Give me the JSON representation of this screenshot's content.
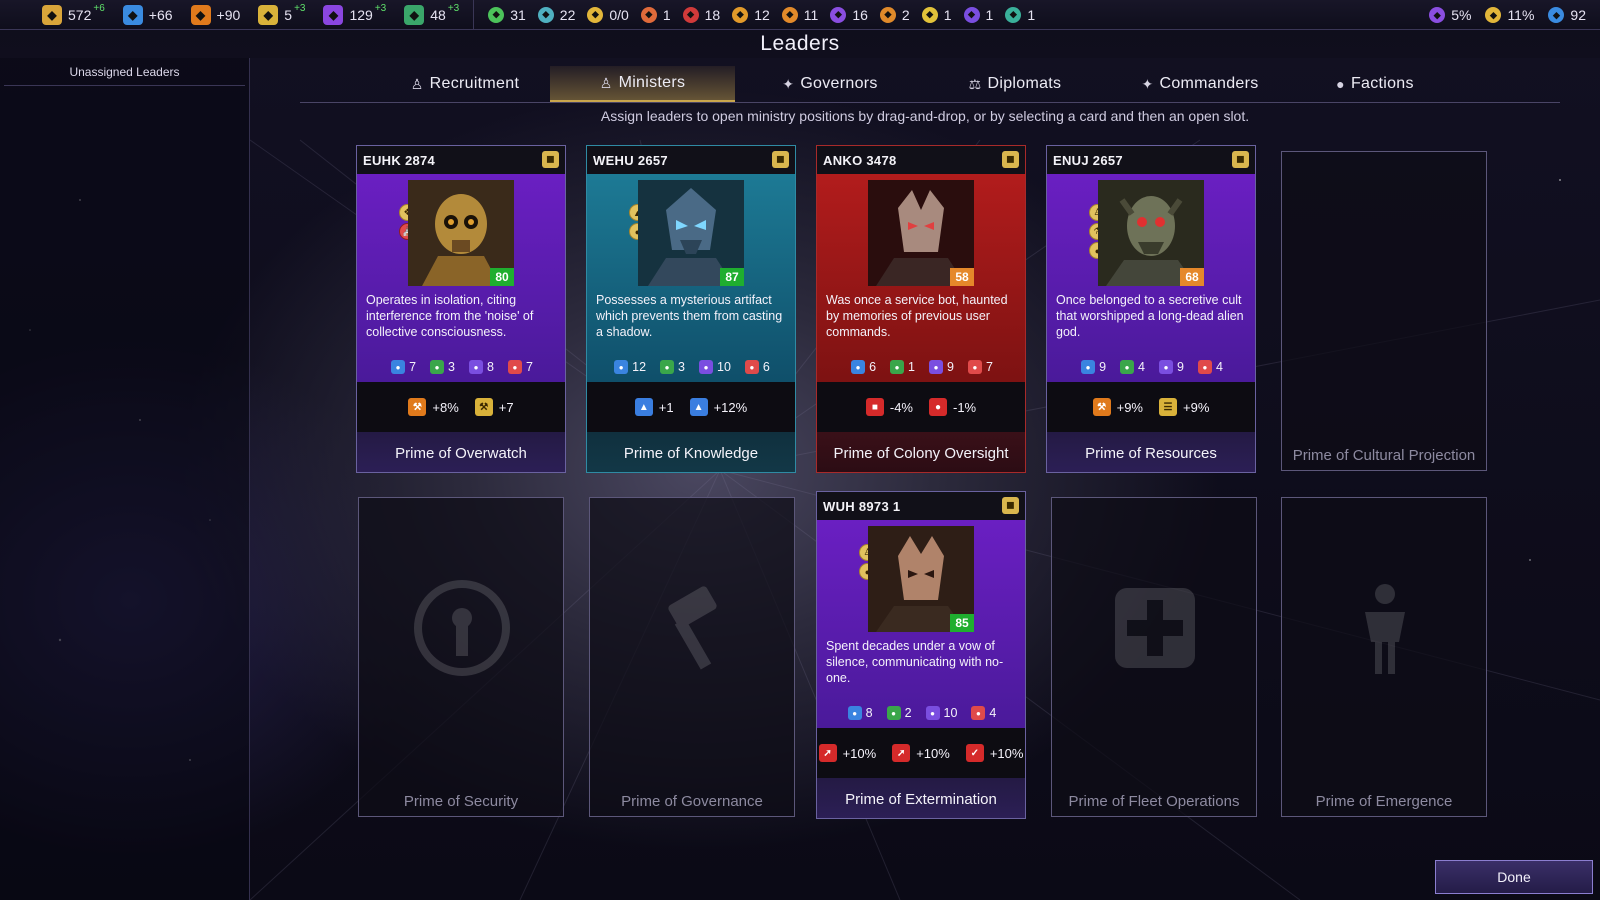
{
  "window": {
    "title": "Leaders"
  },
  "topbar": {
    "resources": [
      {
        "icon": "influence-icon",
        "value": "572",
        "delta": "+6",
        "color": "#d9a53a"
      },
      {
        "icon": "science-icon",
        "value": "+66",
        "delta": "",
        "color": "#3a8be0"
      },
      {
        "icon": "industry-icon",
        "value": "+90",
        "delta": "",
        "color": "#e07a1c"
      },
      {
        "icon": "approval-icon",
        "value": "5",
        "delta": "+3",
        "color": "#d9b23a"
      },
      {
        "icon": "manpower-icon",
        "value": "129",
        "delta": "+3",
        "color": "#8a46e0"
      },
      {
        "icon": "food-icon",
        "value": "48",
        "delta": "+3",
        "color": "#3aa66a"
      }
    ],
    "strategic": [
      {
        "icon": "titanium-icon",
        "value": "31",
        "color": "#4cc25a"
      },
      {
        "icon": "hyperium-icon",
        "value": "22",
        "color": "#4fb0c0"
      },
      {
        "icon": "energy-icon",
        "value": "0/0",
        "color": "#e2b63a"
      },
      {
        "icon": "weapons-icon",
        "value": "1",
        "color": "#e06a3a"
      },
      {
        "icon": "antimatter-icon",
        "value": "18",
        "color": "#d03a3a"
      },
      {
        "icon": "ore-icon",
        "value": "12",
        "color": "#e29a2a"
      },
      {
        "icon": "luxury-icon",
        "value": "11",
        "color": "#e28a2a"
      },
      {
        "icon": "dust-icon",
        "value": "16",
        "color": "#8a4ee0"
      },
      {
        "icon": "crystal-icon",
        "value": "2",
        "color": "#e08a2a"
      },
      {
        "icon": "spice-icon",
        "value": "1",
        "color": "#e2c23a"
      },
      {
        "icon": "void-icon",
        "value": "1",
        "color": "#7a4ee0"
      },
      {
        "icon": "gem-icon",
        "value": "1",
        "color": "#3ab09a"
      }
    ],
    "right": [
      {
        "icon": "victory-icon",
        "value": "5%",
        "color": "#8a4ee0"
      },
      {
        "icon": "trophy-icon",
        "value": "11%",
        "color": "#e2b63a"
      },
      {
        "icon": "turn-icon",
        "value": "92",
        "color": "#3a8be0"
      }
    ]
  },
  "left_panel": {
    "header": "Unassigned Leaders"
  },
  "tabs": [
    {
      "label": "Recruitment",
      "icon": "recruitment-icon",
      "active": false
    },
    {
      "label": "Ministers",
      "icon": "ministers-icon",
      "active": true
    },
    {
      "label": "Governors",
      "icon": "governors-icon",
      "active": false
    },
    {
      "label": "Diplomats",
      "icon": "diplomats-icon",
      "active": false
    },
    {
      "label": "Commanders",
      "icon": "commanders-icon",
      "active": false
    },
    {
      "label": "Factions",
      "icon": "factions-icon",
      "active": false
    }
  ],
  "instruction": "Assign leaders to open ministry positions by drag-and-drop, or by selecting a card and then an open slot.",
  "cards": [
    {
      "name": "EUHK 2874",
      "level": "80",
      "color": "purple",
      "desc": "Operates in isolation, citing interference from the 'noise' of collective consciousness.",
      "stats": [
        "7",
        "3",
        "8",
        "7"
      ],
      "bonuses": [
        {
          "icon": "industry-icon",
          "value": "+8%"
        },
        {
          "icon": "ore-icon",
          "value": "+7"
        }
      ],
      "position": "Prime of Overwatch"
    },
    {
      "name": "WEHU 2657",
      "level": "87",
      "color": "teal",
      "desc": "Possesses a mysterious artifact which prevents them from casting a shadow.",
      "stats": [
        "12",
        "3",
        "10",
        "6"
      ],
      "bonuses": [
        {
          "icon": "science-icon",
          "value": "+1"
        },
        {
          "icon": "science-icon",
          "value": "+12%"
        }
      ],
      "position": "Prime of Knowledge"
    },
    {
      "name": "ANKO 3478",
      "level": "58",
      "color": "red",
      "desc": "Was once a service bot, haunted by memories of previous user commands.",
      "stats": [
        "6",
        "1",
        "9",
        "7"
      ],
      "bonuses": [
        {
          "icon": "unrest-icon",
          "value": "-4%"
        },
        {
          "icon": "upkeep-icon",
          "value": "-1%"
        }
      ],
      "position": "Prime of Colony Oversight"
    },
    {
      "name": "ENUJ 2657",
      "level": "68",
      "color": "purple",
      "desc": "Once belonged to a secretive cult that worshipped a long-dead alien god.",
      "stats": [
        "9",
        "4",
        "9",
        "4"
      ],
      "bonuses": [
        {
          "icon": "industry-icon",
          "value": "+9%"
        },
        {
          "icon": "resource-icon",
          "value": "+9%"
        }
      ],
      "position": "Prime of Resources"
    },
    {
      "name": "WUH 8973 1",
      "level": "85",
      "color": "purple",
      "desc": "Spent decades under a vow of silence, communicating with no-one.",
      "stats": [
        "8",
        "2",
        "10",
        "4"
      ],
      "bonuses": [
        {
          "icon": "attack-icon",
          "value": "+10%"
        },
        {
          "icon": "damage-icon",
          "value": "+10%"
        },
        {
          "icon": "accuracy-icon",
          "value": "+10%"
        }
      ],
      "position": "Prime of Extermination"
    }
  ],
  "empty_slots": [
    "Prime of Cultural Projection",
    "Prime of Security",
    "Prime of Governance",
    "Prime of Fleet Operations",
    "Prime of Emergence"
  ],
  "done_label": "Done"
}
